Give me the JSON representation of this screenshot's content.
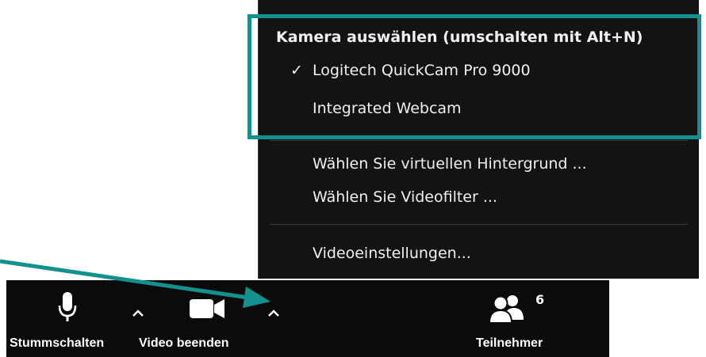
{
  "camera_menu": {
    "section_title": "Kamera auswählen (umschalten mit Alt+N)",
    "cameras": [
      {
        "label": "Logitech QuickCam Pro 9000",
        "selected": true
      },
      {
        "label": "Integrated Webcam",
        "selected": false
      }
    ],
    "check_glyph": "✓",
    "background_item": "Wählen Sie virtuellen Hintergrund ...",
    "filter_item": "Wählen Sie Videofilter ...",
    "settings_item": "Videoeinstellungen..."
  },
  "toolbar": {
    "mute_label": "Stummschalten",
    "video_label": "Video beenden",
    "participants_label": "Teilnehmer",
    "participants_count": "6",
    "icons": [
      "microphone-icon",
      "video-camera-icon",
      "participants-icon",
      "chevron-up-icon"
    ]
  },
  "colors": {
    "highlight": "#13918f",
    "menu_background": "#131313",
    "toolbar_background": "#0b0b0b"
  }
}
